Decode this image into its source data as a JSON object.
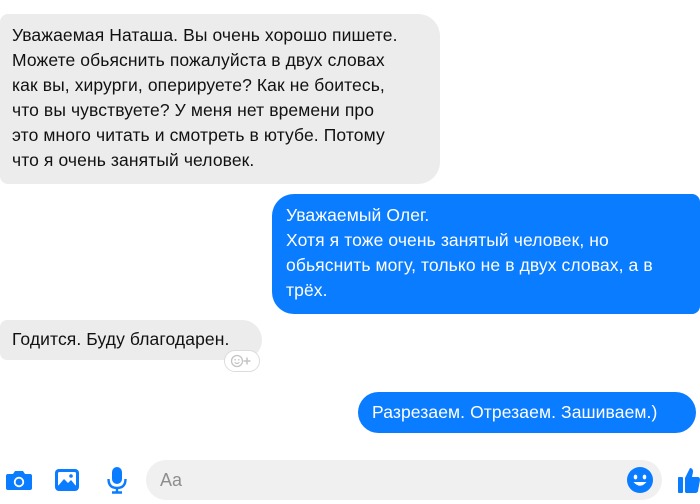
{
  "messages": [
    {
      "direction": "incoming",
      "text": "Уважаемая Наташа. Вы очень хорошо пишете.\nМожете обьяснить пожалуйста в двух словах\nкак вы, хирурги, оперируете? Как не боитесь,\nчто вы чувствуете? У меня нет времени про\nэто много читать и смотреть в ютубе. Потому\nчто я очень занятый человек."
    },
    {
      "direction": "outgoing",
      "text": "Уважаемый Олег.\nХотя я тоже очень занятый человек, но\nобьяснить могу, только не в двух словах, а в\nтрёх."
    },
    {
      "direction": "incoming",
      "text": "Годится. Буду благодарен."
    },
    {
      "direction": "outgoing",
      "text": "Разрезаем. Отрезаем. Зашиваем.)"
    }
  ],
  "composer": {
    "placeholder": "Aa",
    "icons": [
      "camera-icon",
      "image-icon",
      "microphone-icon",
      "emoji-icon",
      "thumbs-up-icon",
      "add-reaction-icon"
    ]
  },
  "colors": {
    "outgoing_bubble": "#0a7cff",
    "incoming_bubble": "#ececec",
    "accent": "#0a7cff"
  }
}
